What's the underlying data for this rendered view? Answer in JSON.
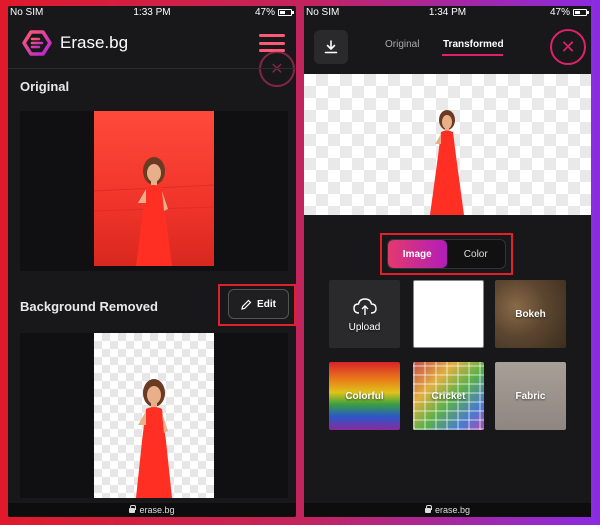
{
  "left": {
    "status": {
      "carrier": "No SIM",
      "time": "1:33 PM",
      "battery": "47%"
    },
    "brand": {
      "name": "Erase.bg"
    },
    "sections": {
      "original": "Original",
      "removed": "Background Removed"
    },
    "edit_label": "Edit",
    "url": "erase.bg"
  },
  "right": {
    "status": {
      "carrier": "No SIM",
      "time": "1:34 PM",
      "battery": "47%"
    },
    "tabs": {
      "original": "Original",
      "transformed": "Transformed"
    },
    "toggle": {
      "image": "Image",
      "color": "Color"
    },
    "backgrounds": {
      "upload": "Upload",
      "bokeh": "Bokeh",
      "colorful": "Colorful",
      "cricket": "Cricket",
      "fabric": "Fabric"
    },
    "url": "erase.bg"
  },
  "colors": {
    "accent": "#e0206a",
    "highlight": "#e0202a",
    "model_dress": "#f03a2e"
  },
  "icons": {
    "download": "download-icon",
    "close": "close-icon",
    "edit": "pencil-icon",
    "upload": "cloud-upload-icon",
    "menu": "hamburger-menu-icon"
  }
}
